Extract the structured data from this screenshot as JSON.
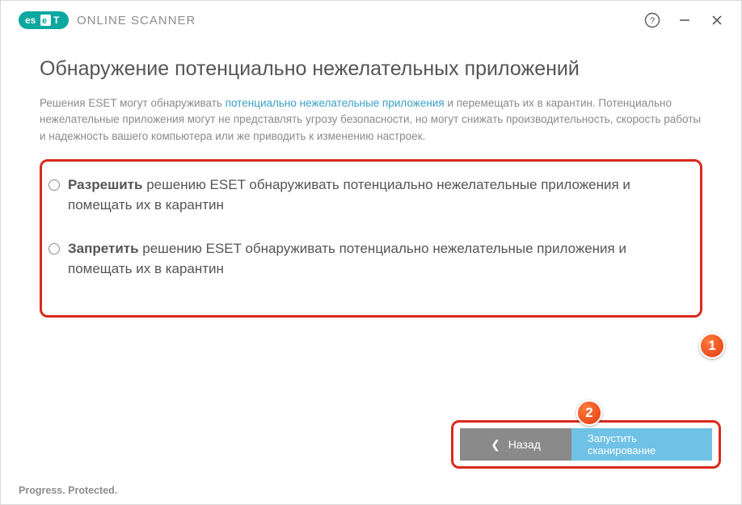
{
  "titlebar": {
    "brand_text": "ONLINE SCANNER",
    "help_title": "Help",
    "minimize_title": "Minimize",
    "close_title": "Close"
  },
  "page": {
    "heading": "Обнаружение потенциально нежелательных приложений",
    "intro_pre": "Решения ESET могут обнаруживать ",
    "intro_link": "потенциально нежелательные приложения",
    "intro_post": " и перемещать их в карантин. Потенциально нежелательные приложения могут не представлять угрозу безопасности, но могут снижать производительность, скорость работы и надежность вашего компьютера или же приводить к изменению настроек."
  },
  "options": [
    {
      "bold": "Разрешить",
      "rest": " решению ESET обнаруживать потенциально нежелательные приложения и помещать их в карантин"
    },
    {
      "bold": "Запретить",
      "rest": " решению ESET обнаруживать потенциально нежелательные приложения и помещать их в карантин"
    }
  ],
  "buttons": {
    "back": "Назад",
    "start": "Запустить сканирование"
  },
  "footer": "Progress. Protected.",
  "annotations": {
    "badge1": "1",
    "badge2": "2"
  },
  "colors": {
    "accent": "#3aa0c9",
    "callout": "#d92a1c",
    "badge": "#f05a28",
    "back_btn": "#8a8a8a",
    "start_btn": "#6fc2e6"
  }
}
